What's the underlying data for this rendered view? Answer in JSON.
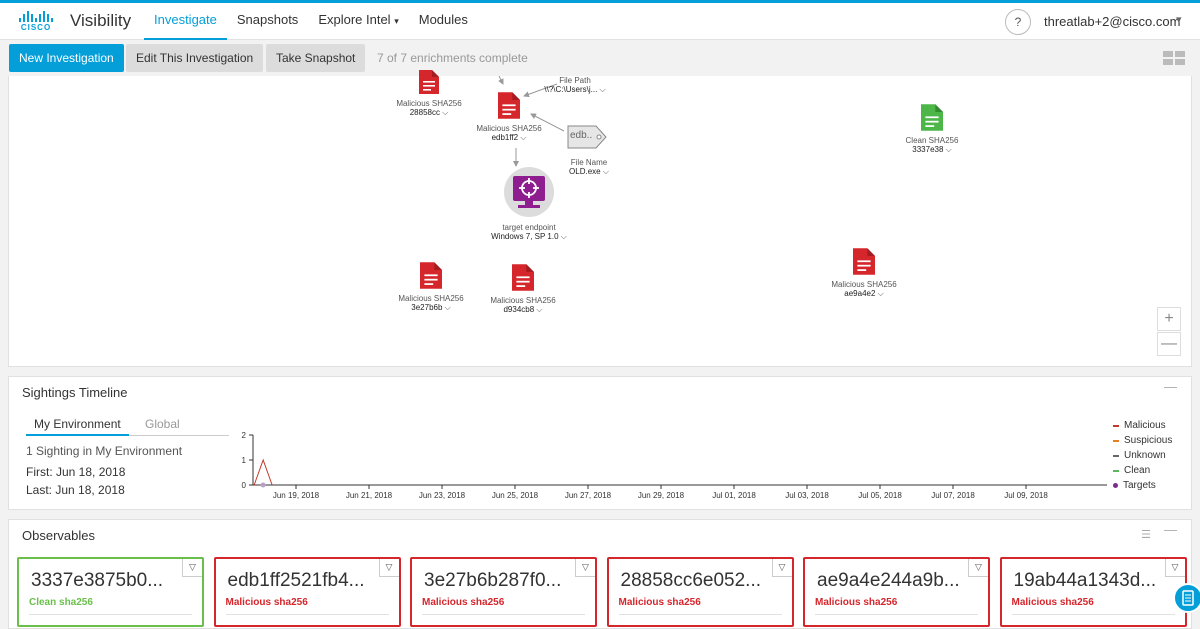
{
  "header": {
    "logo_text": "CISCO",
    "app_title": "Visibility",
    "nav": [
      "Investigate",
      "Snapshots",
      "Explore Intel",
      "Modules"
    ],
    "help": "?",
    "user": "threatlab+2@cisco.com",
    "caret": "⌄"
  },
  "actions": {
    "new_investigation": "New Investigation",
    "edit_investigation": "Edit This Investigation",
    "take_snapshot": "Take Snapshot",
    "enrichments": "7 of 7 enrichments complete"
  },
  "graph": {
    "nodes": [
      {
        "label": "Malicious SHA256",
        "value": "28858cc"
      },
      {
        "label": "Malicious SHA256",
        "value": "edb1ff2"
      },
      {
        "label": "File Path",
        "value": "\\\\?\\C:\\Users\\j..."
      },
      {
        "label": "File Name",
        "value": "OLD.exe"
      },
      {
        "label": "target endpoint",
        "value": "Windows 7, SP 1.0"
      },
      {
        "label": "Clean SHA256",
        "value": "3337e38"
      },
      {
        "label": "Malicious SHA256",
        "value": "3e27b6b"
      },
      {
        "label": "Malicious SHA256",
        "value": "d934cb8"
      },
      {
        "label": "Malicious SHA256",
        "value": "ae9a4e2"
      }
    ],
    "tag_text": "edb..",
    "zoom_in": "+",
    "zoom_out": "—"
  },
  "sightings": {
    "title": "Sightings Timeline",
    "minimize": "—",
    "tab_env": "My Environment",
    "tab_global": "Global",
    "count_text": "1 Sighting in My Environment",
    "first": "First: Jun 18, 2018",
    "last": "Last: Jun 18, 2018",
    "legend": [
      "Malicious",
      "Suspicious",
      "Unknown",
      "Clean",
      "Targets"
    ],
    "legend_colors": [
      "#c0392b",
      "#e67e22",
      "#666666",
      "#5cb85c",
      "#7b2d8e"
    ]
  },
  "chart_data": {
    "type": "line",
    "x": [
      "Jun 18, 2018",
      "Jun 19, 2018"
    ],
    "series": [
      {
        "name": "Malicious",
        "values": [
          1,
          0
        ]
      }
    ],
    "ylim": [
      0,
      2
    ],
    "yticks": [
      "2",
      "1",
      "0"
    ],
    "xticks": [
      "Jun 19, 2018",
      "Jun 21, 2018",
      "Jun 23, 2018",
      "Jun 25, 2018",
      "Jun 27, 2018",
      "Jun 29, 2018",
      "Jul 01, 2018",
      "Jul 03, 2018",
      "Jul 05, 2018",
      "Jul 07, 2018",
      "Jul 09, 2018"
    ]
  },
  "observables": {
    "title": "Observables",
    "minimize": "—",
    "cards": [
      {
        "hash": "3337e3875b0...",
        "status": "Clean sha256",
        "clean": true
      },
      {
        "hash": "edb1ff2521fb4...",
        "status": "Malicious sha256",
        "clean": false
      },
      {
        "hash": "3e27b6b287f0...",
        "status": "Malicious sha256",
        "clean": false
      },
      {
        "hash": "28858cc6e052...",
        "status": "Malicious sha256",
        "clean": false
      },
      {
        "hash": "ae9a4e244a9b...",
        "status": "Malicious sha256",
        "clean": false
      },
      {
        "hash": "19ab44a1343d...",
        "status": "Malicious sha256",
        "clean": false
      }
    ]
  }
}
